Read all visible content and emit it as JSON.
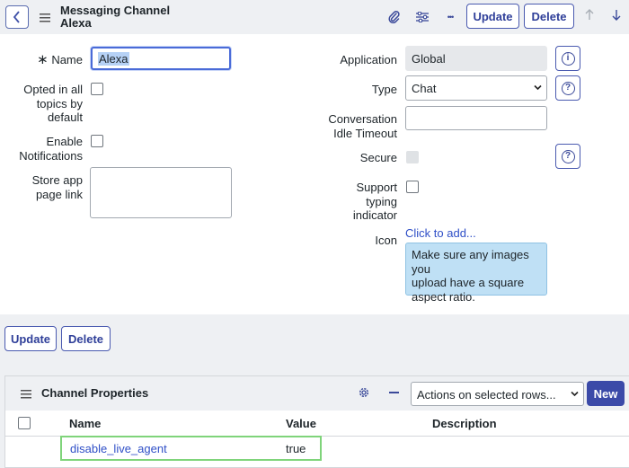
{
  "header": {
    "title_line1": "Messaging Channel",
    "title_line2": "Alexa",
    "update_label": "Update",
    "delete_label": "Delete",
    "more_icon": "•••"
  },
  "form": {
    "name_label": "Name",
    "required_mark": "∗",
    "name_value": "Alexa",
    "opted_in_label_1": "Opted in all",
    "opted_in_label_2": "topics by",
    "opted_in_label_3": "default",
    "enable_notif_label_1": "Enable",
    "enable_notif_label_2": "Notifications",
    "store_link_label_1": "Store app",
    "store_link_label_2": "page link",
    "application_label": "Application",
    "application_value": "Global",
    "type_label": "Type",
    "type_value": "Chat",
    "idle_label_1": "Conversation",
    "idle_label_2": "Idle Timeout",
    "secure_label": "Secure",
    "typing_label_1": "Support",
    "typing_label_2": "typing",
    "typing_label_3": "indicator",
    "icon_label": "Icon",
    "icon_add_link": "Click to add...",
    "icon_hint_1": "Make sure any images you",
    "icon_hint_2": "upload have a square",
    "icon_hint_3": "aspect ratio."
  },
  "footer_buttons": {
    "update_label": "Update",
    "delete_label": "Delete"
  },
  "related_list": {
    "title": "Channel Properties",
    "actions_select": "Actions on selected rows...",
    "new_label": "New",
    "columns": [
      "Name",
      "Value",
      "Description"
    ],
    "rows": [
      {
        "name": "disable_live_agent",
        "value": "true",
        "description": ""
      }
    ]
  },
  "colors": {
    "accent": "#3f51a8",
    "link": "#2f4fc7",
    "highlight": "#7fd47a",
    "hint_bg": "#bfe0f5"
  }
}
